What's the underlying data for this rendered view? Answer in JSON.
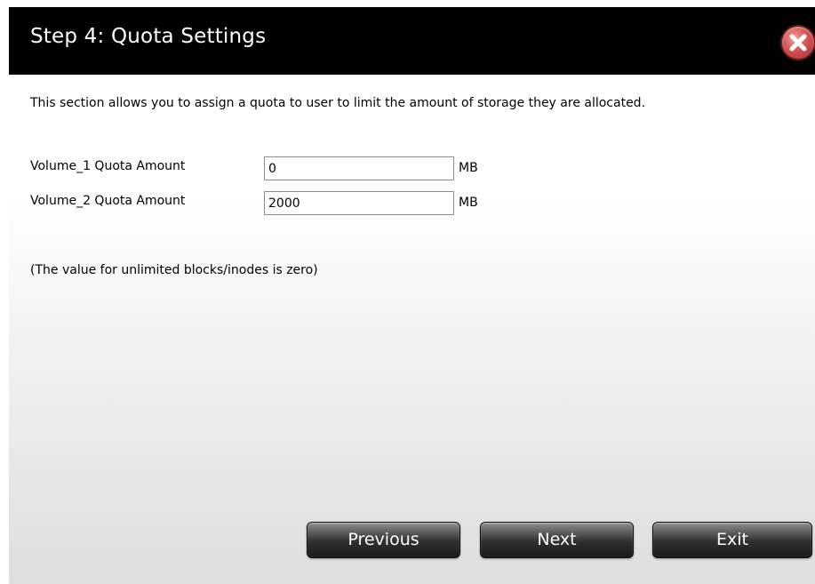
{
  "dialog": {
    "title": "Step 4: Quota Settings",
    "close_icon": "close-icon"
  },
  "content": {
    "description": "This section allows you to assign a quota to user to limit the amount of storage they are allocated.",
    "rows": [
      {
        "label": "Volume_1 Quota Amount",
        "value": "0",
        "unit": "MB"
      },
      {
        "label": "Volume_2 Quota Amount",
        "value": "2000",
        "unit": "MB"
      }
    ],
    "note": "(The value for unlimited blocks/inodes is zero)"
  },
  "buttons": {
    "previous": "Previous",
    "next": "Next",
    "exit": "Exit"
  },
  "colors": {
    "titlebar": "#000000",
    "close_button": "#d45454",
    "button_dark": "#1c1c1c"
  }
}
